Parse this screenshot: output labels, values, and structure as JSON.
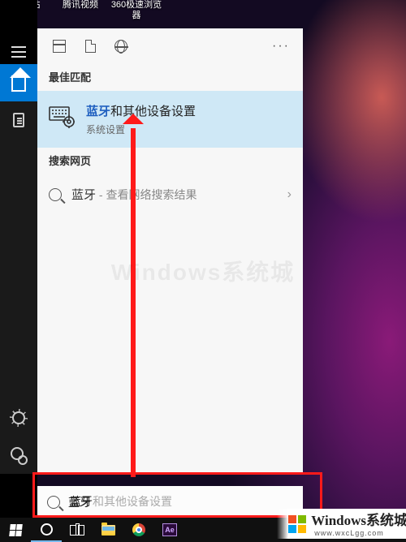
{
  "desktop_icons": {
    "recycle": "回收站",
    "tencent": "腾讯视频",
    "browser360_l1": "360极速浏览",
    "browser360_l2": "器"
  },
  "panel": {
    "best_match_label": "最佳匹配",
    "result": {
      "highlight": "蓝牙",
      "rest": "和其他设备设置",
      "subtitle": "系统设置"
    },
    "web_label": "搜索网页",
    "web_query": "蓝牙",
    "web_hint": " - 查看网络搜索结果"
  },
  "search": {
    "typed": "蓝牙",
    "suggestion_tail": "和其他设备设置"
  },
  "watermark": {
    "brand": "Windows系统城",
    "url": "www.wxcLgg.com"
  }
}
